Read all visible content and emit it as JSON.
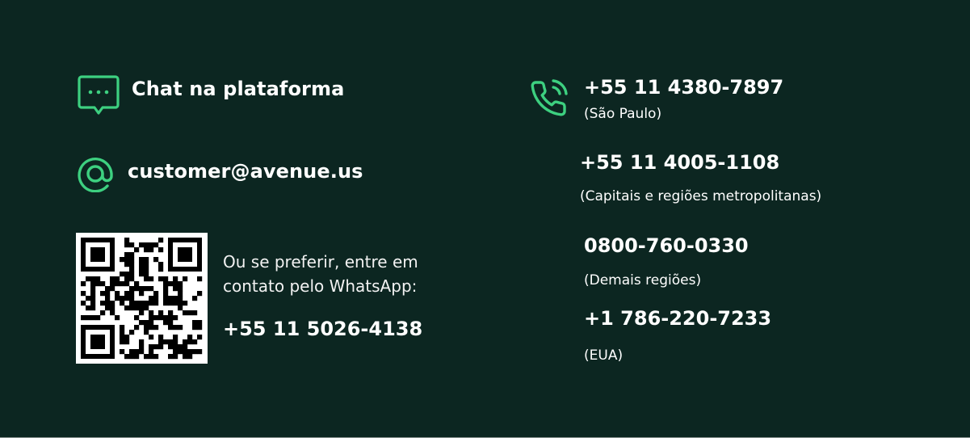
{
  "colors": {
    "background": "#0c2621",
    "accent": "#3dd080",
    "text": "#ffffff",
    "qr_dark": "#000000",
    "qr_light": "#ffffff"
  },
  "chat": {
    "icon": "chat-bubble-icon",
    "label": "Chat na plataforma"
  },
  "email": {
    "icon": "at-sign-icon",
    "address": "customer@avenue.us"
  },
  "whatsapp": {
    "qr": "qr-code",
    "line1": "Ou se preferir, entre em",
    "line2": "contato pelo WhatsApp:",
    "number": "+55 11 5026-4138"
  },
  "phone_icon": "phone-call-icon",
  "phones": [
    {
      "number": "+55 11 4380-7897",
      "region": "(São Paulo)"
    },
    {
      "number": "+55 11 4005-1108",
      "region": "(Capitais e regiões metropolitanas)"
    },
    {
      "number": "0800-760-0330",
      "region": "(Demais regiões)"
    },
    {
      "number": "+1 786-220-7233",
      "region": "(EUA)"
    }
  ]
}
